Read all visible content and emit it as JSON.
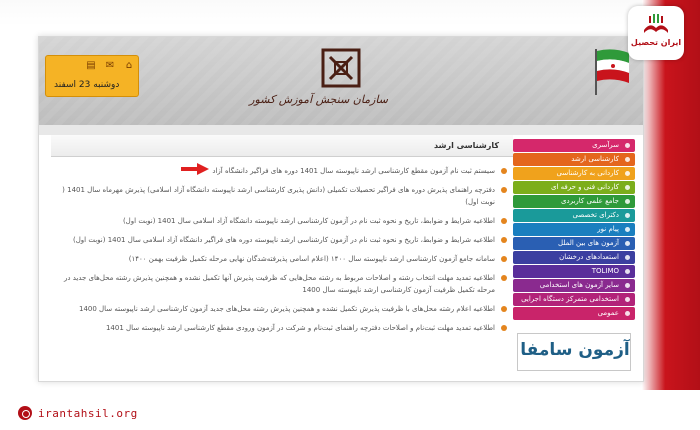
{
  "header": {
    "date": "دوشنبه 23 اسفند",
    "logo_text": "سازمان سنجش آموزش کشور",
    "date_icons": [
      "home-icon",
      "mail-icon",
      "print-icon"
    ]
  },
  "badge": {
    "text": "ایران تحصیل"
  },
  "site": {
    "url": "irantahsil.org"
  },
  "content": {
    "title": "کارشناسی ارشد",
    "items": [
      "سیستم ثبت نام آزمون مقطع کارشناسی ارشد ناپیوسته سال 1401 دوره های فراگیر دانشگاه آزاد",
      "دفترچه راهنمای پذیرش دوره های فراگیر تحصیلات تکمیلی (دانش پذیری کارشناسی ارشد ناپیوسته دانشگاه آزاد اسلامی) پذیرش مهرماه سال 1401 ( نوبت اول)",
      "اطلاعیه شرایط و ضوابط، تاریخ و نحوه ثبت نام در آزمون کارشناسی ارشد ناپیوسته دانشگاه آزاد اسلامی سال 1401 (نوبت اول)",
      "اطلاعیه شرایط و ضوابط، تاریخ و نحوه ثبت نام در آزمون کارشناسی ارشد ناپیوسته دوره های فراگیر دانشگاه آزاد اسلامی سال 1401 (نوبت اول)",
      "سامانه جامع آزمون کارشناسی ارشد ناپیوسته سال ۱۴۰۰ (اعلام اسامی پذیرفته‌شدگان نهایی مرحله تکمیل ظرفیت بهمن ۱۴۰۰)",
      "اطلاعیه تمدید مهلت انتخاب رشته و اصلاحات مربوط به رشته محل‌هایی که ظرفیت پذیرش آنها تکمیل نشده و همچنین پذیرش رشته محل‌های جدید در مرحله تکمیل ظرفیت آزمون کارشناسی ارشد ناپیوسته سال 1400",
      "اطلاعیه اعلام رشته محل‌های با ظرفیت پذیرش تکمیل نشده و همچنین پذیرش رشته محل‌های جدید آزمون کارشناسی ارشد ناپیوسته سال 1400",
      "اطلاعیه تمدید مهلت ثبت‌نام و اصلاحات دفترچه راهنمای ثبت‌نام و شرکت در آزمون ورودی مقطع کارشناسی ارشد ناپیوسته سال 1401"
    ]
  },
  "menu": [
    {
      "label": "سرآسری",
      "color": "#d5286b"
    },
    {
      "label": "کارشناسی ارشد",
      "color": "#e4661d"
    },
    {
      "label": "کاردانی به کارشناسی",
      "color": "#f0a21c"
    },
    {
      "label": "کاردانی فنی و حرفه ای",
      "color": "#7cae1b"
    },
    {
      "label": "جامع علمی کاربردی",
      "color": "#2f9a3a"
    },
    {
      "label": "دکترای تخصصی",
      "color": "#1a9a9a"
    },
    {
      "label": "پیام نور",
      "color": "#1a7fbf"
    },
    {
      "label": "آزمون های بین الملل",
      "color": "#2a5fb3"
    },
    {
      "label": "استعدادهای درخشان",
      "color": "#3b3fa0"
    },
    {
      "label": "TOLIMO",
      "color": "#5a2e9a"
    },
    {
      "label": "سایر آزمون های استخدامی",
      "color": "#8a2a8f"
    },
    {
      "label": "استخدامی متمرکز دستگاه اجرایی",
      "color": "#b22379"
    },
    {
      "label": "عمومی",
      "color": "#c9246a"
    }
  ],
  "ad": {
    "text": "آزمون سامفا"
  },
  "colors": {
    "brand_red": "#b20f17",
    "accent_orange": "#e4851e",
    "date_yellow": "#f5b325"
  }
}
